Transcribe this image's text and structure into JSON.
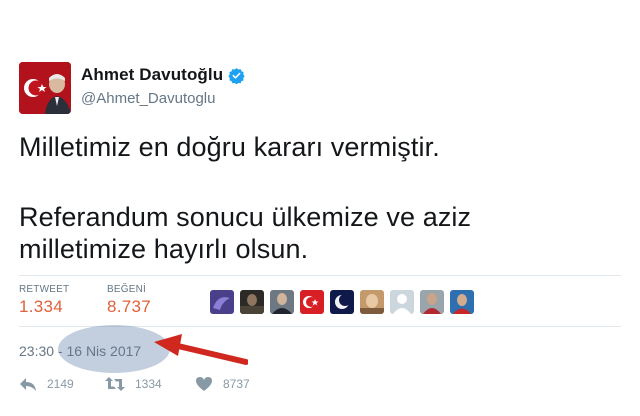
{
  "tweet": {
    "display_name": "Ahmet Davutoğlu",
    "handle": "@Ahmet_Davutoglu",
    "verified": true,
    "text_lines": [
      "Milletimiz en doğru kararı vermiştir.",
      "Referandum sonucu ülkemize ve aziz",
      "milletimize hayırlı olsun."
    ],
    "stats": {
      "retweet_label": "RETWEET",
      "retweet_value": "1.334",
      "like_label": "BEĞENİ",
      "like_value": "8.737"
    },
    "timestamp": "23:30 - 16 Nis 2017",
    "actions": {
      "reply_count": "2149",
      "retweet_count": "1334",
      "like_count": "8737"
    }
  },
  "colors": {
    "accent_orange": "#e0603a",
    "verified_blue": "#1da1f2",
    "muted": "#657786",
    "highlight": "#6080ac",
    "arrow": "#d0281e"
  }
}
